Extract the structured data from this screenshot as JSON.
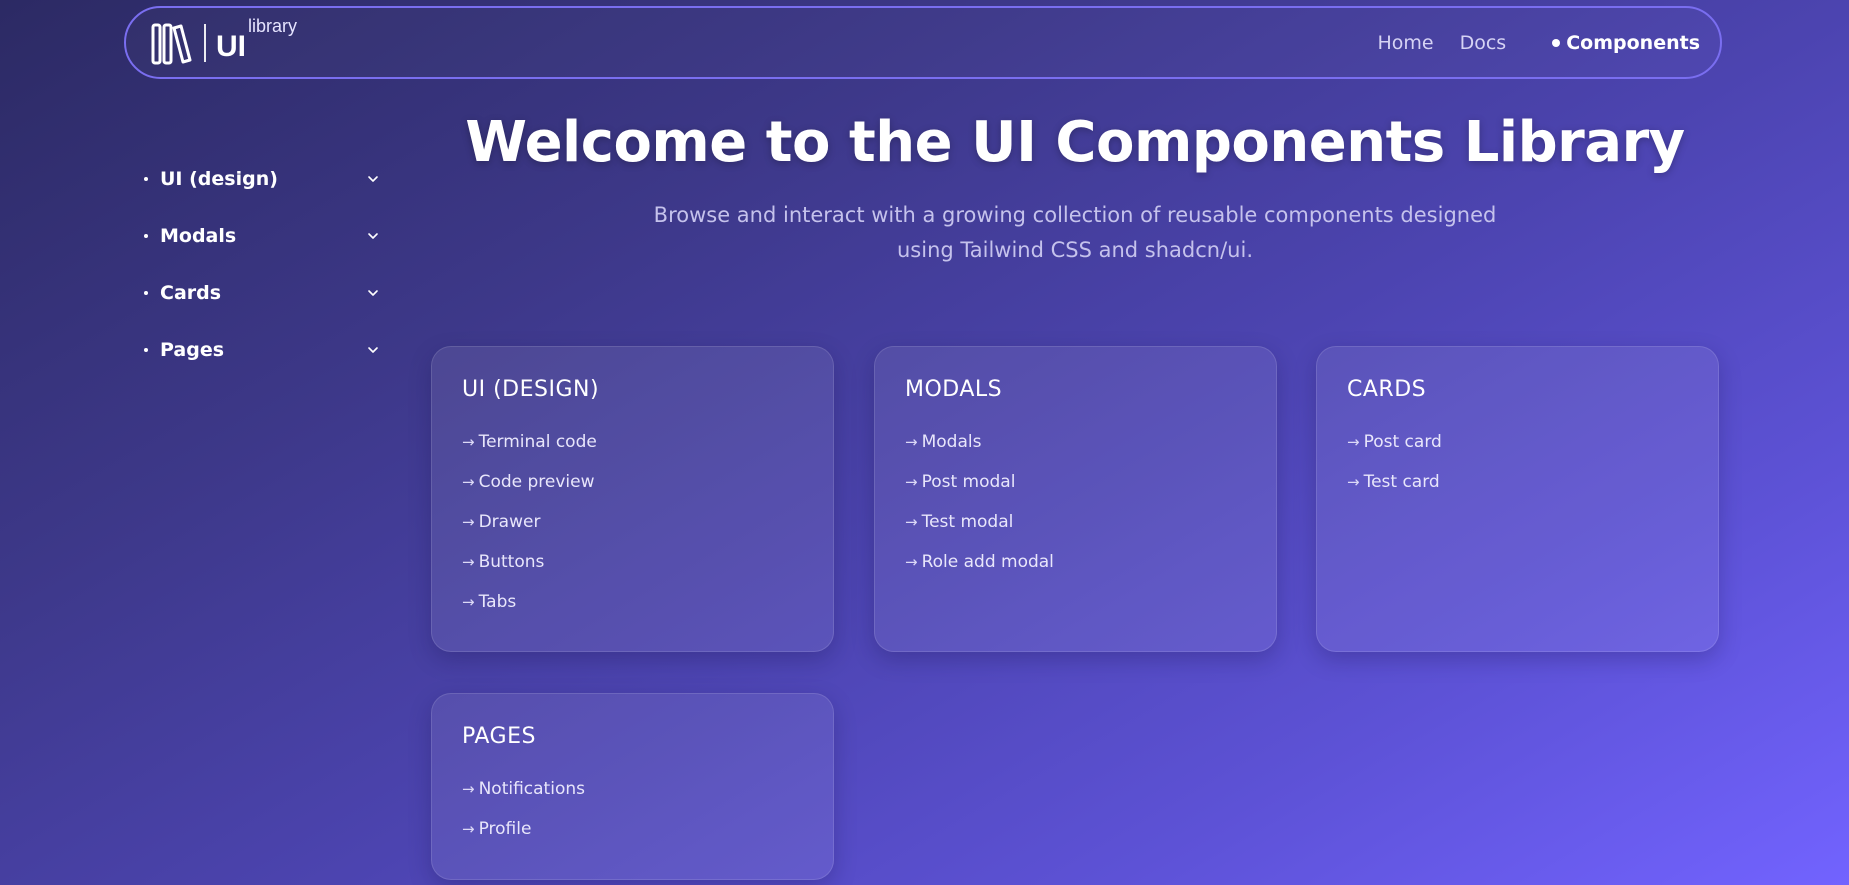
{
  "nav": {
    "logo_text": "UI",
    "logo_sup": "library",
    "links": [
      {
        "label": "Home"
      },
      {
        "label": "Docs"
      },
      {
        "label": "Components"
      }
    ]
  },
  "sidebar": {
    "items": [
      {
        "label": "UI (design)"
      },
      {
        "label": "Modals"
      },
      {
        "label": "Cards"
      },
      {
        "label": "Pages"
      }
    ]
  },
  "hero": {
    "title": "Welcome to the UI Components Library",
    "subtitle_line1": "Browse and interact with a growing collection of reusable components designed",
    "subtitle_line2": "using Tailwind CSS and shadcn/ui."
  },
  "cards": [
    {
      "title": "UI (DESIGN)",
      "items": [
        "Terminal code",
        "Code preview",
        "Drawer",
        "Buttons",
        "Tabs"
      ]
    },
    {
      "title": "MODALS",
      "items": [
        "Modals",
        "Post modal",
        "Test modal",
        "Role add modal"
      ]
    },
    {
      "title": "CARDS",
      "items": [
        "Post card",
        "Test card"
      ]
    },
    {
      "title": "PAGES",
      "items": [
        "Notifications",
        "Profile"
      ]
    }
  ],
  "arrow_glyph": "→",
  "colors": {
    "accent_border": "#7a6ef0",
    "bg_start": "#2c2a64",
    "bg_end": "#7263ff"
  }
}
